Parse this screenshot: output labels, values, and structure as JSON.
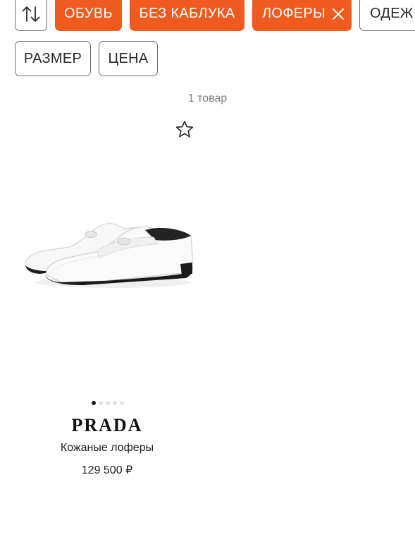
{
  "filters": {
    "sort_icon": "sort-arrows-icon",
    "chips": {
      "shoes": "ОБУВЬ",
      "no_heel": "БЕЗ КАБЛУКА",
      "loafers": "ЛОФЕРЫ",
      "clothes": "ОДЕЖ",
      "size": "РАЗМЕР",
      "price": "ЦЕНА"
    },
    "active_color": "#ef5a1f"
  },
  "results": {
    "count_label": "1 товар"
  },
  "product": {
    "favorite_icon": "star-outline-icon",
    "image_alt": "white leather loafers",
    "images_total": 5,
    "image_active_index": 0,
    "brand": "PRADA",
    "name": "Кожаные лоферы",
    "price": "129 500 ₽"
  }
}
